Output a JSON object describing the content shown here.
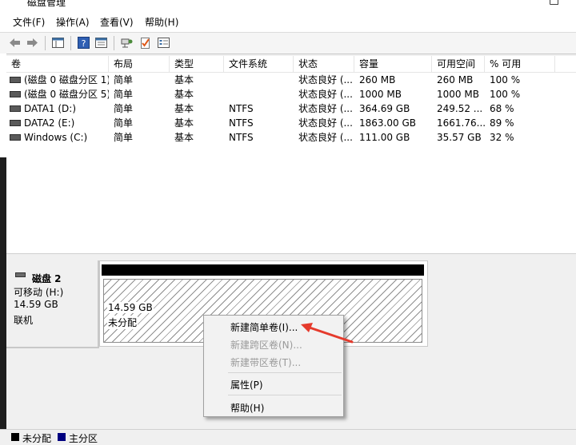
{
  "window": {
    "title": "磁盘管理"
  },
  "menu": [
    "文件(F)",
    "操作(A)",
    "查看(V)",
    "帮助(H)"
  ],
  "volume_list": {
    "columns": [
      "卷",
      "布局",
      "类型",
      "文件系统",
      "状态",
      "容量",
      "可用空间",
      "% 可用"
    ],
    "rows": [
      [
        "(磁盘 0 磁盘分区 1)",
        "简单",
        "基本",
        "",
        "状态良好 (...",
        "260 MB",
        "260 MB",
        "100 %"
      ],
      [
        "(磁盘 0 磁盘分区 5)",
        "简单",
        "基本",
        "",
        "状态良好 (...",
        "1000 MB",
        "1000 MB",
        "100 %"
      ],
      [
        "DATA1 (D:)",
        "简单",
        "基本",
        "NTFS",
        "状态良好 (...",
        "364.69 GB",
        "249.52 ...",
        "68 %"
      ],
      [
        "DATA2 (E:)",
        "简单",
        "基本",
        "NTFS",
        "状态良好 (...",
        "1863.00 GB",
        "1661.76...",
        "89 %"
      ],
      [
        "Windows (C:)",
        "简单",
        "基本",
        "NTFS",
        "状态良好 (...",
        "111.00 GB",
        "35.57 GB",
        "32 %"
      ]
    ]
  },
  "disk": {
    "name": "磁盘 2",
    "type": "可移动 (H:)",
    "size": "14.59 GB",
    "status": "联机",
    "partition_size": "14.59 GB",
    "partition_state": "未分配"
  },
  "context_menu": {
    "new_simple": "新建简单卷(I)...",
    "new_spanned": "新建跨区卷(N)...",
    "new_striped": "新建带区卷(T)...",
    "properties": "属性(P)",
    "help": "帮助(H)"
  },
  "legend": {
    "unallocated": "未分配",
    "primary": "主分区"
  },
  "colors": {
    "unallocated": "#000000",
    "primary": "#000080",
    "annotation_arrow": "#e53a2c"
  }
}
